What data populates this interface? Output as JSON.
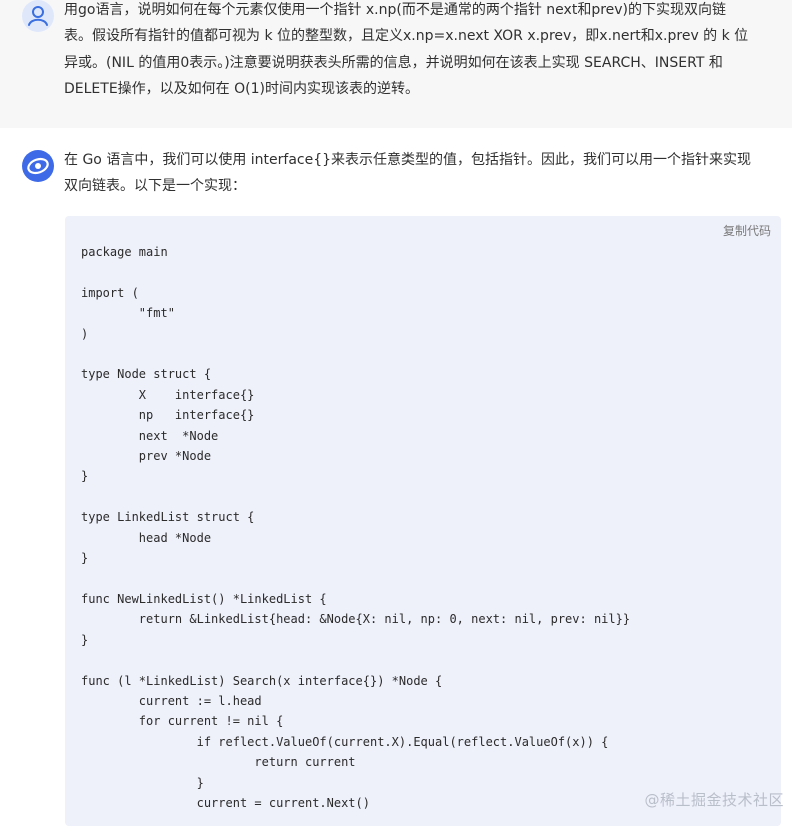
{
  "user_message": {
    "avatar_icon": "user-icon",
    "text": "用go语言，说明如何在每个元素仅使用一个指针 x.np(而不是通常的两个指针 next和prev)的下实现双向链\n表。假设所有指针的值都可视为 k 位的整型数，且定义x.np=x.next XOR x.prev，即x.nert和x.prev 的 k 位\n异或。(NIL 的值用0表示。)注意要说明获表头所需的信息，并说明如何在该表上实现 SEARCH、INSERT 和\nDELETE操作，以及如何在 O(1)时间内实现该表的逆转。"
  },
  "assistant_message": {
    "avatar_icon": "ai-logo-icon",
    "text": "在 Go 语言中，我们可以使用 interface{}来表示任意类型的值，包括指针。因此，我们可以用一个指针来实现\n双向链表。以下是一个实现：",
    "code_block": {
      "copy_label": "复制代码",
      "code": "package main\n\nimport (\n\t\"fmt\"\n)\n\ntype Node struct {\n\tX    interface{}\n\tnp   interface{}\n\tnext  *Node\n\tprev *Node\n}\n\ntype LinkedList struct {\n\thead *Node\n}\n\nfunc NewLinkedList() *LinkedList {\n\treturn &LinkedList{head: &Node{X: nil, np: 0, next: nil, prev: nil}}\n}\n\nfunc (l *LinkedList) Search(x interface{}) *Node {\n\tcurrent := l.head\n\tfor current != nil {\n\t\tif reflect.ValueOf(current.X).Equal(reflect.ValueOf(x)) {\n\t\t\treturn current\n\t\t}\n\t\tcurrent = current.Next()"
    }
  },
  "watermark": "@稀土掘金技术社区",
  "colors": {
    "user_bg": "#f7f7f8",
    "code_bg": "#eef0fa",
    "assistant_logo": "#3e6ae8"
  }
}
